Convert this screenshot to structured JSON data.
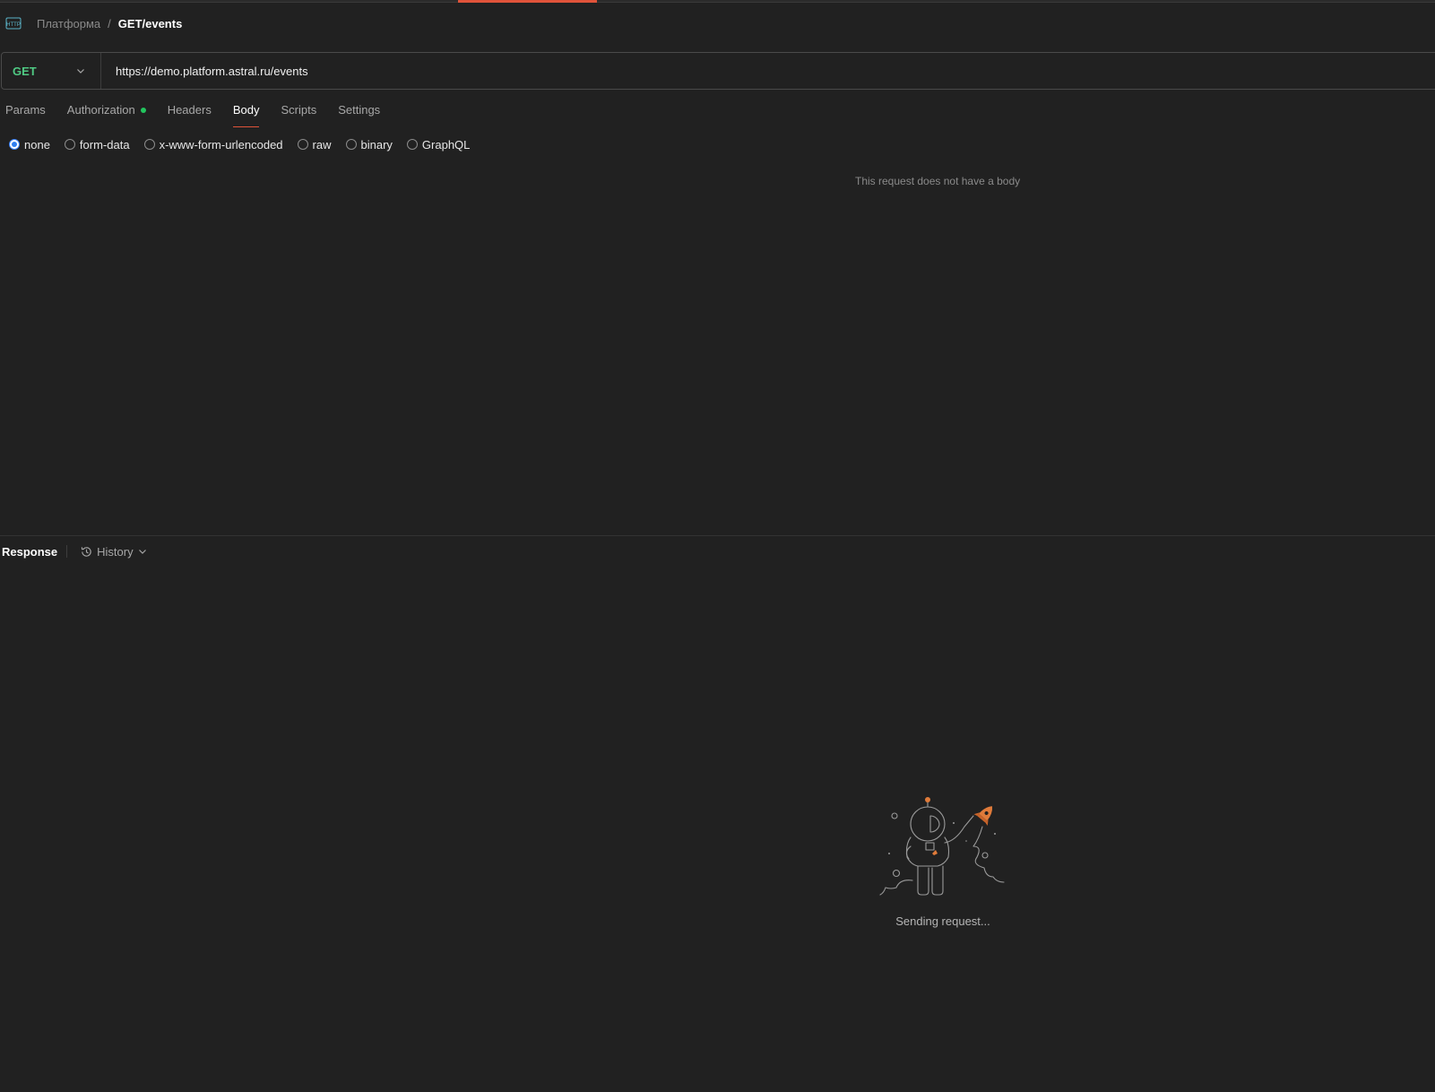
{
  "breadcrumb": {
    "icon": "http-icon",
    "parent": "Платформа",
    "separator": "/",
    "current": "GET/events"
  },
  "request": {
    "method": "GET",
    "url": "https://demo.platform.astral.ru/events"
  },
  "tabs": [
    {
      "label": "Params",
      "active": false
    },
    {
      "label": "Authorization",
      "active": false,
      "indicator": true
    },
    {
      "label": "Headers",
      "active": false
    },
    {
      "label": "Body",
      "active": true
    },
    {
      "label": "Scripts",
      "active": false
    },
    {
      "label": "Settings",
      "active": false
    }
  ],
  "body_types": [
    {
      "label": "none",
      "selected": true
    },
    {
      "label": "form-data",
      "selected": false
    },
    {
      "label": "x-www-form-urlencoded",
      "selected": false
    },
    {
      "label": "raw",
      "selected": false
    },
    {
      "label": "binary",
      "selected": false
    },
    {
      "label": "GraphQL",
      "selected": false
    }
  ],
  "body_empty_message": "This request does not have a body",
  "response": {
    "title": "Response",
    "history_label": "History",
    "status_message": "Sending request..."
  },
  "colors": {
    "background": "#212121",
    "accent": "#e0533a",
    "method_get": "#4fc983",
    "auth_indicator": "#22c55e",
    "radio_selected": "#2f7ff0"
  }
}
